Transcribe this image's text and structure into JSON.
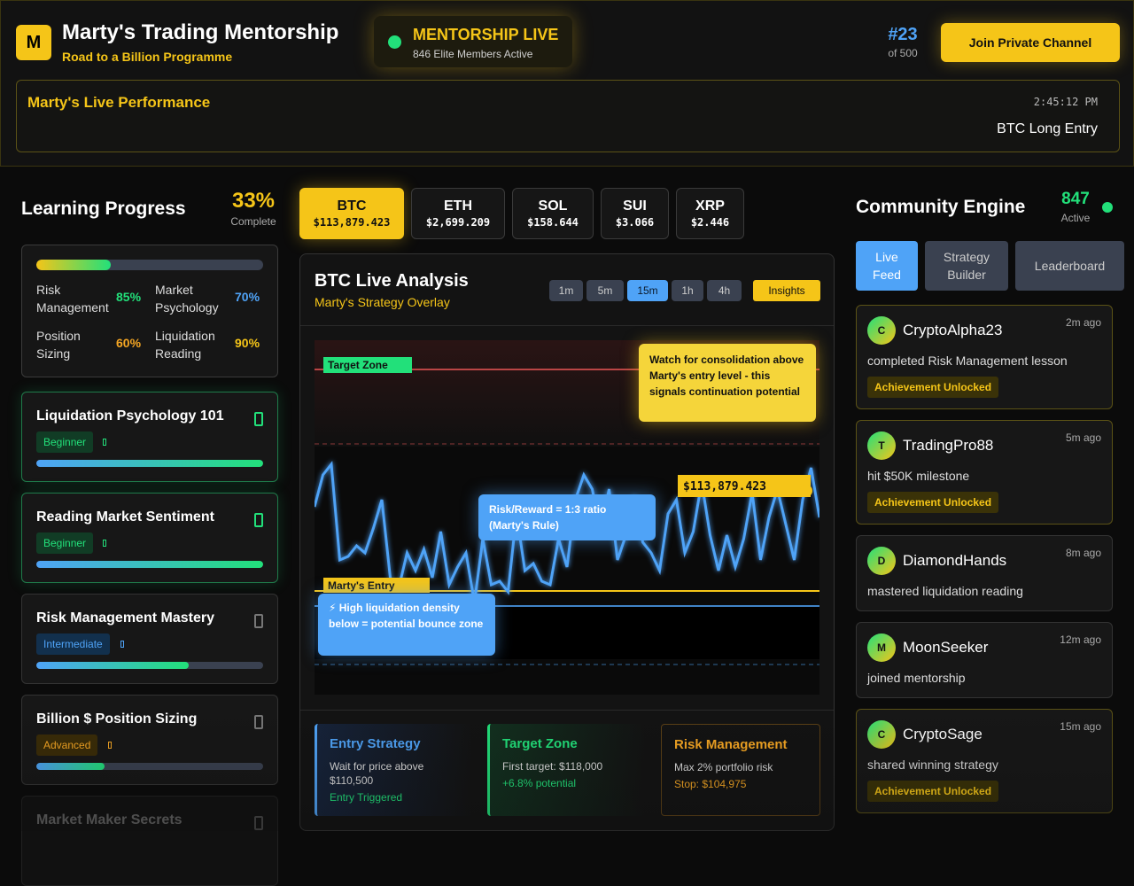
{
  "header": {
    "logo_letter": "M",
    "title": "Marty's Trading Mentorship",
    "subtitle": "Road to a Billion Programme",
    "live": {
      "title": "MENTORSHIP LIVE",
      "members": "846 Elite Members Active"
    },
    "rank": {
      "number": "#23",
      "of": "of 500"
    },
    "join_label": "Join Private Channel",
    "performance": {
      "title": "Marty's Live Performance",
      "time": "2:45:12 PM",
      "entry": "BTC Long Entry"
    }
  },
  "learning": {
    "title": "Learning Progress",
    "percent": "33%",
    "percent_label": "Complete",
    "progress": 0.33,
    "skills": [
      {
        "name": "Risk Management",
        "value": "85%",
        "color": "#22e07a"
      },
      {
        "name": "Market Psychology",
        "value": "70%",
        "color": "#4fa3f7"
      },
      {
        "name": "Position Sizing",
        "value": "60%",
        "color": "#f5a623"
      },
      {
        "name": "Liquidation Reading",
        "value": "90%",
        "color": "#f5c518"
      }
    ],
    "courses": [
      {
        "title": "Liquidation Psychology 101",
        "level": "Beginner",
        "progress": 1.0
      },
      {
        "title": "Reading Market Sentiment",
        "level": "Beginner",
        "progress": 1.0
      },
      {
        "title": "Risk Management Mastery",
        "level": "Intermediate",
        "progress": 0.67
      },
      {
        "title": "Billion $ Position Sizing",
        "level": "Advanced",
        "progress": 0.3
      },
      {
        "title": "Market Maker Secrets"
      }
    ]
  },
  "tickers": [
    {
      "symbol": "BTC",
      "price": "$113,879.423"
    },
    {
      "symbol": "ETH",
      "price": "$2,699.209"
    },
    {
      "symbol": "SOL",
      "price": "$158.644"
    },
    {
      "symbol": "SUI",
      "price": "$3.066"
    },
    {
      "symbol": "XRP",
      "price": "$2.446"
    }
  ],
  "analysis": {
    "title": "BTC Live Analysis",
    "subtitle": "Marty's Strategy Overlay",
    "timeframes": [
      "1m",
      "5m",
      "15m",
      "1h",
      "4h"
    ],
    "active_timeframe": "15m",
    "insights_label": "Insights",
    "target_label": "Target Zone",
    "entry_label": "Marty's Entry",
    "price_tag": "$113,879.423",
    "notes": {
      "consolidation": "Watch for consolidation above Marty's entry level - this signals continuation potential",
      "risk_reward": "Risk/Reward = 1:3 ratio (Marty's Rule)",
      "liquidation": "⚡ High liquidation density below = potential bounce zone"
    },
    "cards": {
      "entry": {
        "title": "Entry Strategy",
        "desc": "Wait for price above $110,500",
        "status": "Entry Triggered"
      },
      "target": {
        "title": "Target Zone",
        "desc": "First target: $118,000",
        "status": "+6.8% potential"
      },
      "risk": {
        "title": "Risk Management",
        "desc": "Max 2% portfolio risk",
        "status": "Stop: $104,975"
      }
    }
  },
  "chart_data": {
    "type": "line",
    "series": [
      {
        "values": [
          0.53,
          0.62,
          0.65,
          0.38,
          0.39,
          0.42,
          0.4,
          0.47,
          0.55,
          0.33,
          0.3,
          0.4,
          0.35,
          0.41,
          0.33,
          0.46,
          0.31,
          0.36,
          0.4,
          0.26,
          0.44,
          0.31,
          0.32,
          0.29,
          0.51,
          0.35,
          0.37,
          0.32,
          0.31,
          0.44,
          0.36,
          0.55,
          0.62,
          0.58,
          0.46,
          0.58,
          0.38,
          0.45,
          0.56,
          0.43,
          0.4,
          0.35,
          0.51,
          0.55,
          0.4,
          0.46,
          0.6,
          0.45,
          0.35,
          0.45,
          0.36,
          0.44,
          0.57,
          0.38,
          0.5,
          0.58,
          0.48,
          0.38,
          0.55,
          0.64,
          0.5
        ]
      }
    ]
  },
  "community": {
    "title": "Community Engine",
    "active_count": "847",
    "active_label": "Active",
    "tabs": [
      "Live Feed",
      "Strategy Builder",
      "Leaderboard"
    ],
    "feed": [
      {
        "initial": "C",
        "user": "CryptoAlpha23",
        "ago": "2m ago",
        "action": "completed Risk Management lesson",
        "badge": "Achievement Unlocked"
      },
      {
        "initial": "T",
        "user": "TradingPro88",
        "ago": "5m ago",
        "action": "hit $50K milestone",
        "badge": "Achievement Unlocked"
      },
      {
        "initial": "D",
        "user": "DiamondHands",
        "ago": "8m ago",
        "action": "mastered liquidation reading"
      },
      {
        "initial": "M",
        "user": "MoonSeeker",
        "ago": "12m ago",
        "action": "joined mentorship"
      },
      {
        "initial": "C",
        "user": "CryptoSage",
        "ago": "15m ago",
        "action": "shared winning strategy",
        "badge": "Achievement Unlocked"
      }
    ]
  }
}
